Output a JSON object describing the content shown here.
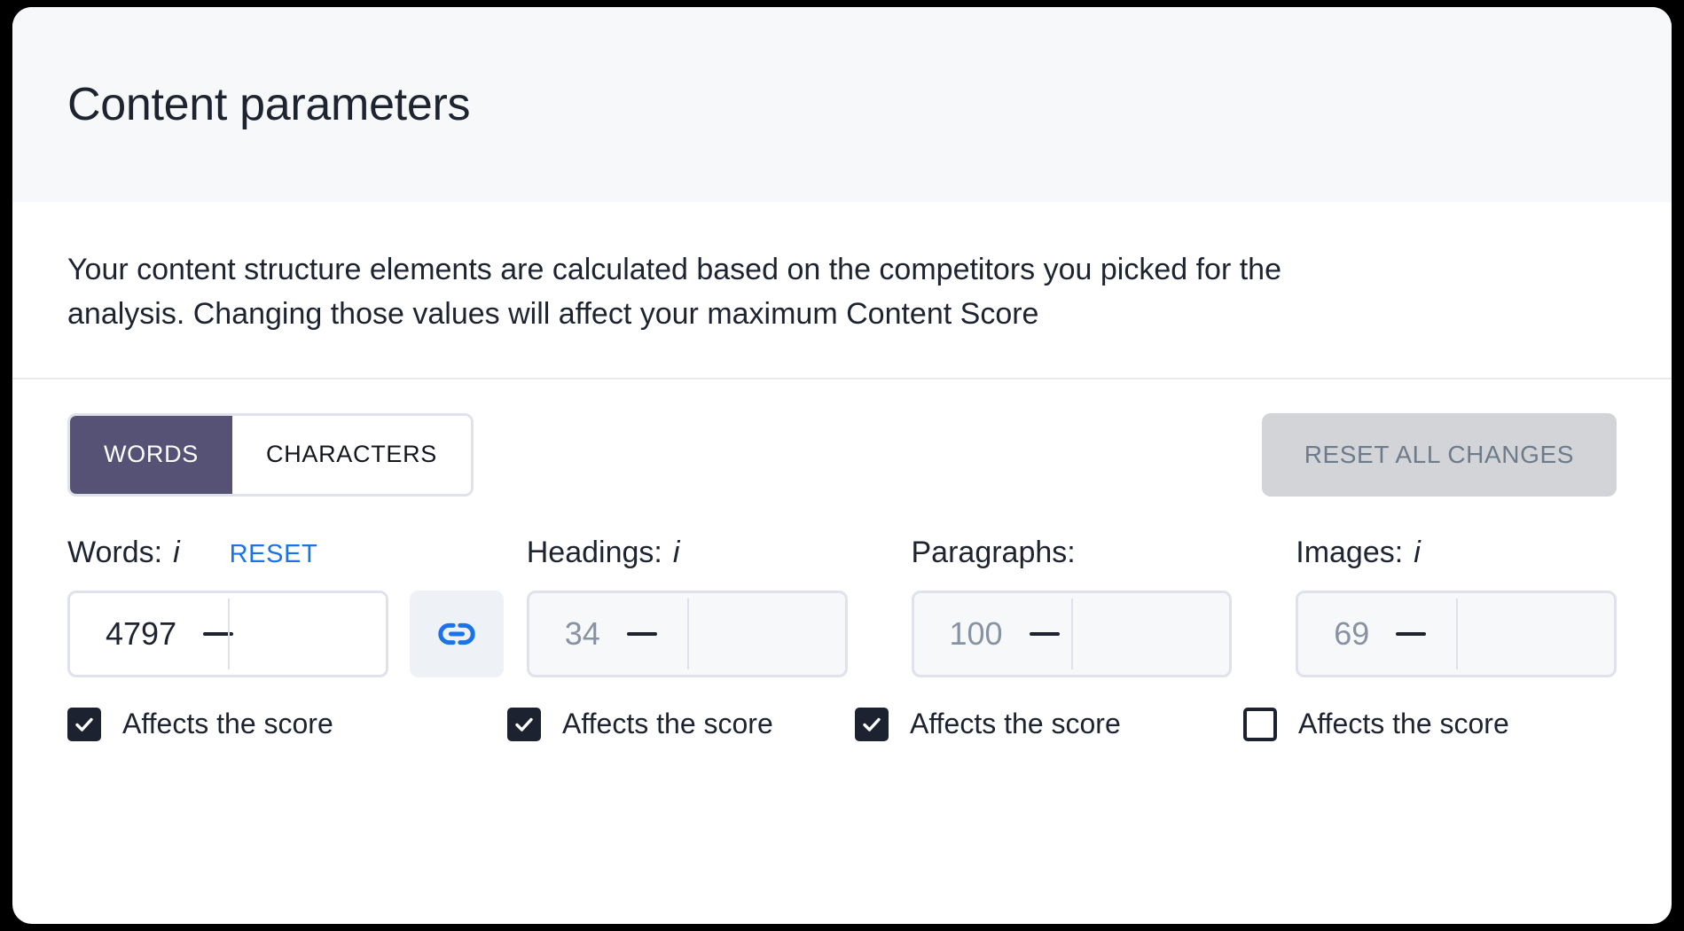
{
  "card": {
    "title": "Content parameters",
    "description": "Your content structure elements are calculated based on the competitors you picked for the analysis. Changing those values will affect your maximum Content Score"
  },
  "toggle": {
    "words_label": "WORDS",
    "characters_label": "CHARACTERS",
    "active": "WORDS"
  },
  "reset_all": {
    "label": "RESET ALL CHANGES",
    "disabled": true
  },
  "fields": [
    {
      "label": "Words:",
      "has_info_icon": true,
      "reset_label": "RESET",
      "value": "4797",
      "enabled": true,
      "checkbox_label": "Affects the score",
      "checked": true
    },
    {
      "label": "Headings:",
      "has_info_icon": true,
      "value": "34",
      "enabled": false,
      "checkbox_label": "Affects the score",
      "checked": true
    },
    {
      "label": "Paragraphs:",
      "has_info_icon": false,
      "value": "100",
      "enabled": false,
      "checkbox_label": "Affects the score",
      "checked": true
    },
    {
      "label": "Images:",
      "has_info_icon": true,
      "value": "69",
      "enabled": false,
      "checkbox_label": "Affects the score",
      "checked": false
    }
  ],
  "icons": {
    "info": "i",
    "link": "link-icon",
    "check": "checkmark-icon",
    "minus": "minus-icon"
  },
  "colors": {
    "accent_purple": "#565275",
    "link_blue": "#1a73e8",
    "dark": "#1c2230",
    "header_bg": "#f7f8fa",
    "disabled_btn_bg": "#d2d4d7",
    "disabled_btn_text": "#6d7b8b"
  }
}
